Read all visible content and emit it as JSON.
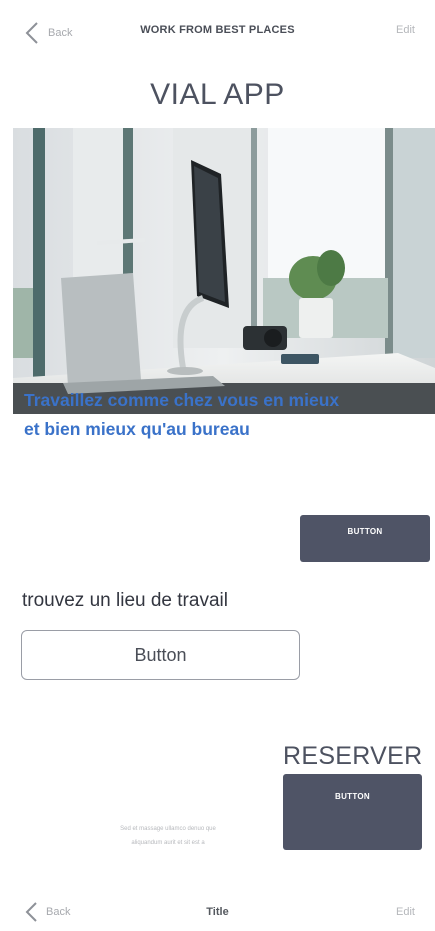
{
  "top_nav": {
    "back_label": "Back",
    "title": "WORK FROM BEST PLACES",
    "edit_label": "Edit"
  },
  "app_heading": "VIAL APP",
  "tagline": {
    "line1": "Travaillez comme chez vous en mieux",
    "line2": "et bien  mieux qu'au bureau"
  },
  "small_button_label": "BUTTON",
  "search_label": "trouvez un lieu de travail",
  "outline_button_label": "Button",
  "reserver_title": "RESERVER",
  "reserver_button_label": "BUTTON",
  "small_note": {
    "line1": "Sed et massage ullamco denuo que",
    "line2": "aliquandum aurit et sit est a"
  },
  "bottom_nav": {
    "back_label": "Back",
    "title": "Title",
    "edit_label": "Edit"
  },
  "colors": {
    "accent_blue": "#3a72c9",
    "dark_button": "#4f5466",
    "heading": "#4d5260"
  },
  "icons": [
    "chevron-left-icon"
  ]
}
